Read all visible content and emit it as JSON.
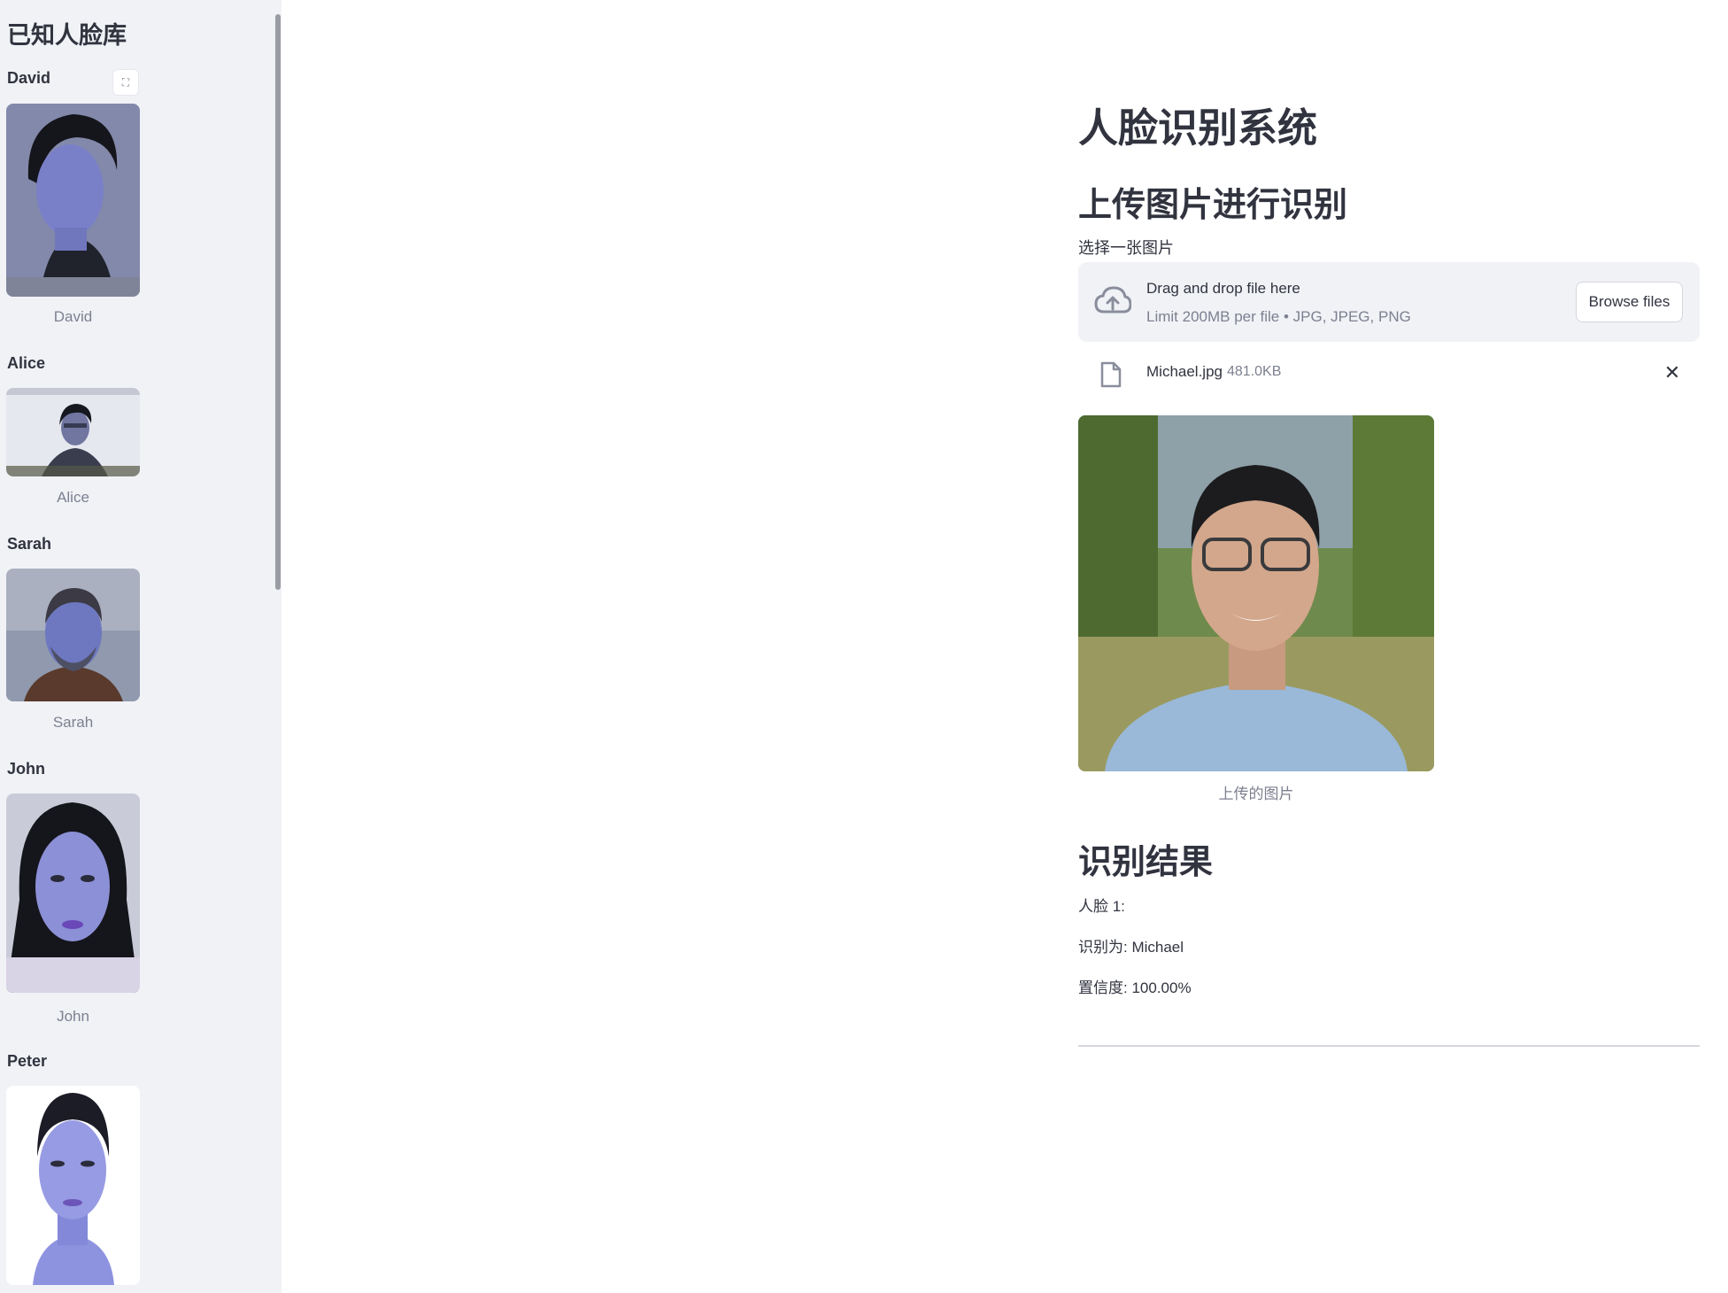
{
  "sidebar": {
    "title": "已知人脸库",
    "people": [
      {
        "label": "David",
        "caption": "David"
      },
      {
        "label": "Alice",
        "caption": "Alice"
      },
      {
        "label": "Sarah",
        "caption": "Sarah"
      },
      {
        "label": "John",
        "caption": "John"
      },
      {
        "label": "Peter",
        "caption": ""
      }
    ],
    "fullscreen_icon": "expand-icon"
  },
  "main": {
    "title": "人脸识别系统",
    "upload_section_title": "上传图片进行识别",
    "uploader": {
      "label": "选择一张图片",
      "drop_text": "Drag and drop file here",
      "limit_text": "Limit 200MB per file • JPG, JPEG, PNG",
      "browse_label": "Browse files",
      "icon": "cloud-upload-icon"
    },
    "file": {
      "name": "Michael.jpg",
      "size": "481.0KB",
      "icon": "file-icon",
      "remove_icon": "close-icon"
    },
    "image_caption": "上传的图片",
    "results_title": "识别结果",
    "results": {
      "face_label": "人脸 1:",
      "identified": "识别为: Michael",
      "confidence": "置信度: 100.00%"
    }
  },
  "colors": {
    "sidebar_bg": "#f0f2f6",
    "text": "#31333f",
    "muted": "#7d8090"
  }
}
